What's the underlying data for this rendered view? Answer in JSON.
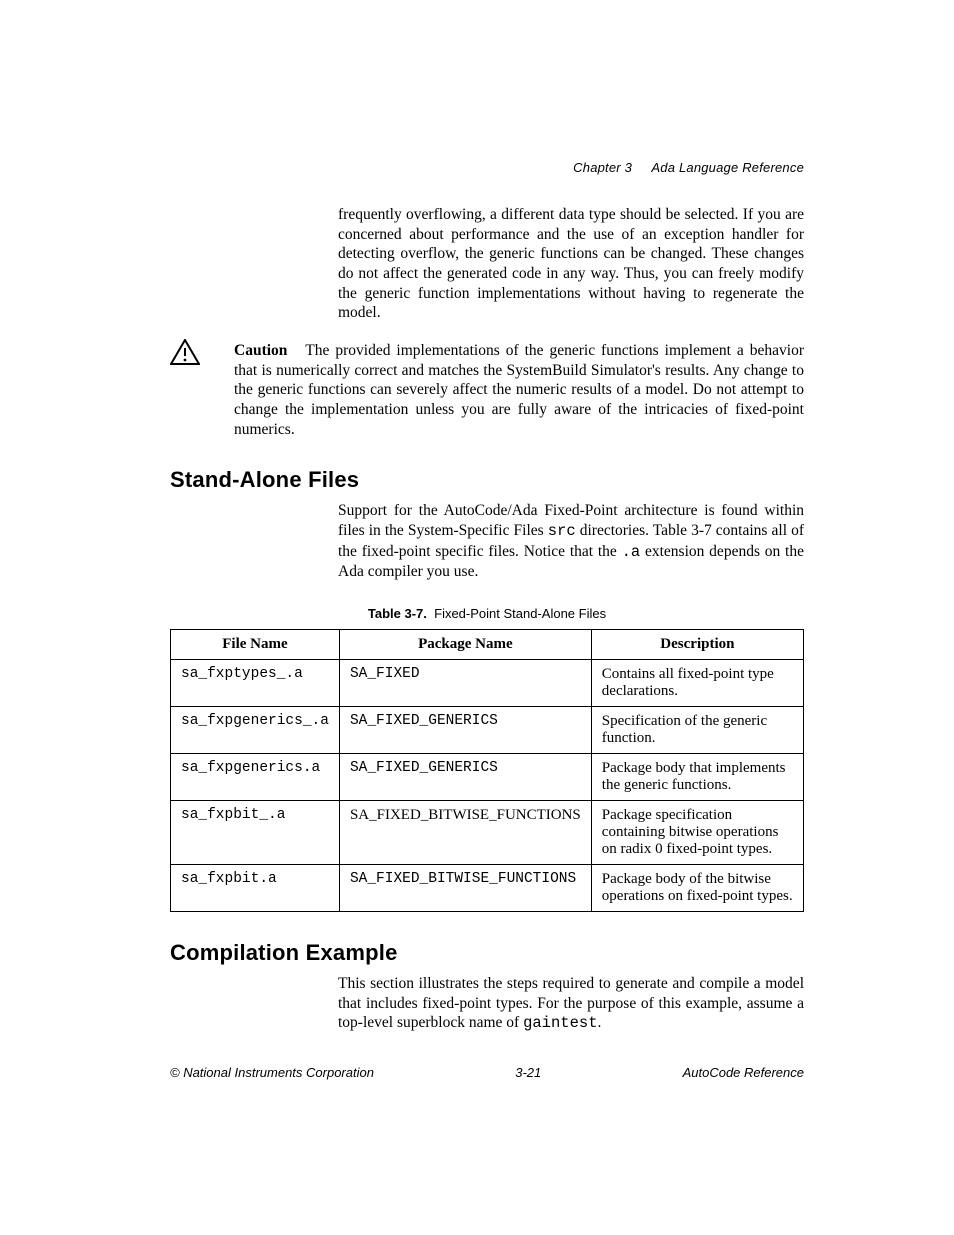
{
  "header": {
    "chapter": "Chapter 3",
    "title": "Ada Language Reference"
  },
  "intro_para": "frequently overflowing, a different data type should be selected. If you are concerned about performance and the use of an exception handler for detecting overflow, the generic functions can be changed. These changes do not affect the generated code in any way. Thus, you can freely modify the generic function implementations without having to regenerate the model.",
  "caution": {
    "label": "Caution",
    "text": "The provided implementations of the generic functions implement a behavior that is numerically correct and matches the SystemBuild Simulator's results. Any change to the generic functions can severely affect the numeric results of a model. Do not attempt to change the implementation unless you are fully aware of the intricacies of fixed-point numerics."
  },
  "section1": {
    "heading": "Stand-Alone Files",
    "para_pre": "Support for the AutoCode/Ada Fixed-Point architecture is found within files in the System-Specific Files ",
    "code1": "src",
    "para_mid": " directories. Table 3-7 contains all of the fixed-point specific files. Notice that the ",
    "code2": ".a",
    "para_post": " extension depends on the Ada compiler you use."
  },
  "table": {
    "caption_num": "Table 3-7.",
    "caption_title": "Fixed-Point Stand-Alone Files",
    "headers": {
      "c1": "File Name",
      "c2": "Package Name",
      "c3": "Description"
    },
    "rows": [
      {
        "file": "sa_fxptypes_.a",
        "pkg": "SA_FIXED",
        "desc": "Contains all fixed-point type declarations."
      },
      {
        "file": "sa_fxpgenerics_.a",
        "pkg": "SA_FIXED_GENERICS",
        "desc": "Specification of the generic function."
      },
      {
        "file": "sa_fxpgenerics.a",
        "pkg": "SA_FIXED_GENERICS",
        "desc": "Package body that implements the generic functions."
      },
      {
        "file": "sa_fxpbit_.a",
        "pkg": "SA_FIXED_BITWISE_FUNCTIONS",
        "desc": "Package specification containing bitwise operations on radix 0 fixed-point types."
      },
      {
        "file": "sa_fxpbit.a",
        "pkg": "SA_FIXED_BITWISE_FUNCTIONS",
        "desc": "Package body of the bitwise operations on fixed-point types."
      }
    ]
  },
  "section2": {
    "heading": "Compilation Example",
    "para_pre": "This section illustrates the steps required to generate and compile a model that includes fixed-point types. For the purpose of this example, assume a top-level superblock name of ",
    "code": "gaintest",
    "para_post": "."
  },
  "footer": {
    "left": "© National Instruments Corporation",
    "center": "3-21",
    "right": "AutoCode Reference"
  }
}
